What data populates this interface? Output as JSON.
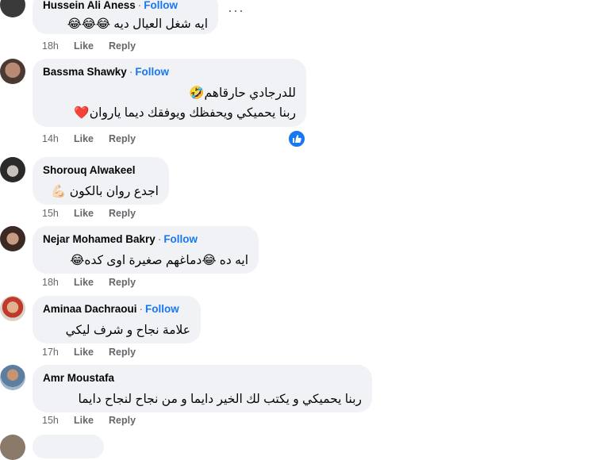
{
  "follow_label": "Follow",
  "separator": "·",
  "actions": {
    "like": "Like",
    "reply": "Reply"
  },
  "comments": [
    {
      "name": "Hussein Ali Aness",
      "text": "ايه شغل العيال ديه 😂😂😂",
      "time": "18h",
      "follow": true
    },
    {
      "name": "Bassma Shawky",
      "lines": [
        "للدرجادي حارقاهم🤣",
        "ربنا يحميكي ويحفظك ويوفقك ديما ياروان❤️"
      ],
      "time": "14h",
      "follow": true,
      "reaction": "like-icon"
    },
    {
      "name": "Shorouq Alwakeel",
      "text": "اجدع روان بالكون 💪🏻",
      "time": "15h",
      "follow": false
    },
    {
      "name": "Nejar Mohamed Bakry",
      "text": "ايه ده 😂دماغهم صغيرة اوى كده😂",
      "time": "18h",
      "follow": true
    },
    {
      "name": "Aminaa Dachraoui",
      "text": "علامة نجاح و شرف ليكي",
      "time": "17h",
      "follow": true
    },
    {
      "name": "Amr Moustafa",
      "text": "ربنا يحميكي و يكتب لك الخير دايما و من نجاح لنجاح دايما",
      "time": "15h",
      "follow": false
    }
  ],
  "colors": {
    "bubble": "#f0f2f5",
    "follow": "#1877f2",
    "meta": "#65676b"
  }
}
